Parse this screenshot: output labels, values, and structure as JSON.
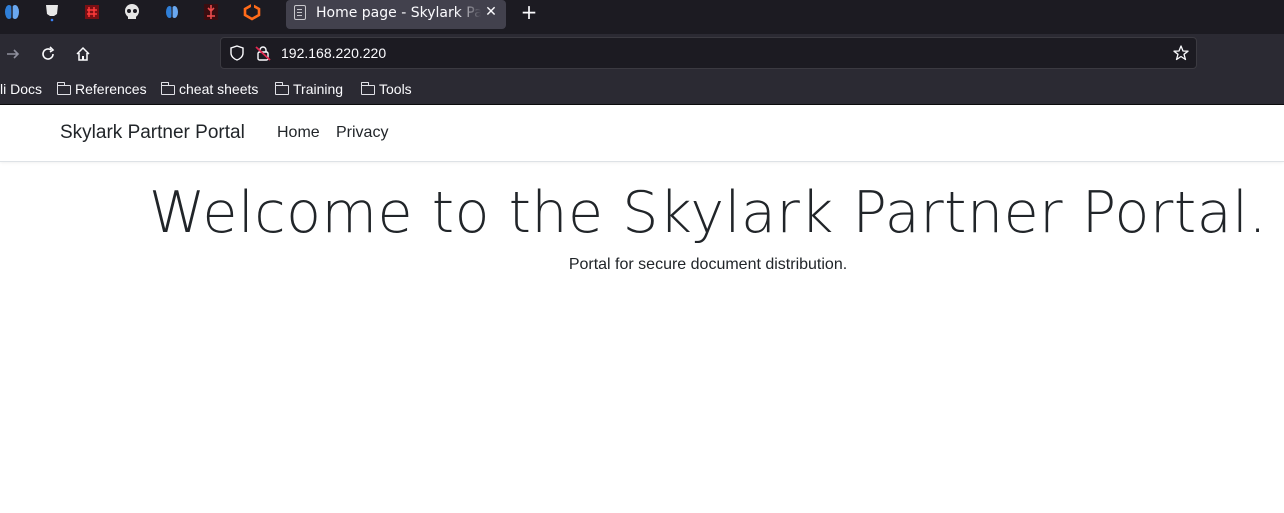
{
  "browser": {
    "tab": {
      "title": "Home page - Skylark Partner Portal"
    },
    "url": "192.168.220.220",
    "bookmarks": [
      {
        "label": "li Docs"
      },
      {
        "label": "References"
      },
      {
        "label": "cheat sheets"
      },
      {
        "label": "Training"
      },
      {
        "label": "Tools"
      }
    ],
    "taskbar_icons": [
      "app-icon-1",
      "app-icon-2",
      "app-icon-3",
      "skull-icon",
      "app-icon-5",
      "app-icon-6",
      "app-icon-7"
    ]
  },
  "site": {
    "brand": "Skylark Partner Portal",
    "nav": [
      {
        "label": "Home"
      },
      {
        "label": "Privacy"
      }
    ],
    "heading": "Welcome to the Skylark Partner Portal.",
    "subtitle": "Portal for secure document distribution."
  },
  "colors": {
    "tab_bar": "#1c1b22",
    "toolbar": "#2b2a33",
    "active_tab": "#42414d",
    "text": "#212529"
  }
}
